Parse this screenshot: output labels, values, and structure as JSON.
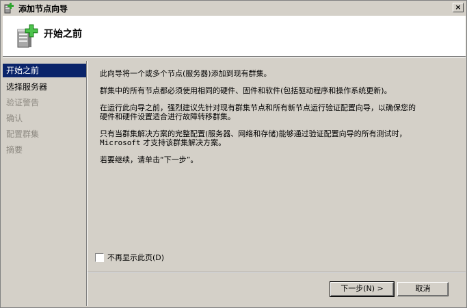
{
  "window": {
    "title": "添加节点向导",
    "close_label": "×"
  },
  "header": {
    "title": "开始之前"
  },
  "nav": {
    "items": [
      {
        "label": "开始之前",
        "state": "active"
      },
      {
        "label": "选择服务器",
        "state": "enabled"
      },
      {
        "label": "验证警告",
        "state": "disabled"
      },
      {
        "label": "确认",
        "state": "disabled"
      },
      {
        "label": "配置群集",
        "state": "disabled"
      },
      {
        "label": "摘要",
        "state": "disabled"
      }
    ]
  },
  "content": {
    "p1": "此向导将一个或多个节点(服务器)添加到现有群集。",
    "p2": "群集中的所有节点都必须使用相同的硬件、固件和软件(包括驱动程序和操作系统更新)。",
    "p3_line1": "在运行此向导之前，强烈建议先针对现有群集节点和所有新节点运行验证配置向导，以确保您的",
    "p3_line2": "硬件和硬件设置适合进行故障转移群集。",
    "p4_line1": "只有当群集解决方案的完整配置(服务器、网络和存储)能够通过验证配置向导的所有测试时，",
    "p4_microsoft": "Microsoft",
    "p4_line2_rest": " 才支持该群集解决方案。",
    "p5": "若要继续，请单击“下一步”。"
  },
  "options": {
    "dont_show_label": "不再显示此页(D)",
    "dont_show_checked": false
  },
  "buttons": {
    "next_label": "下一步(N) >",
    "cancel_label": "取消"
  },
  "colors": {
    "window_bg": "#d4d0c8",
    "nav_active_bg": "#0a246a",
    "disabled_text": "#8e8a82",
    "icon_green": "#2fa52f"
  },
  "icons": {
    "title": "wizard-add-node-icon",
    "header": "server-add-icon"
  }
}
